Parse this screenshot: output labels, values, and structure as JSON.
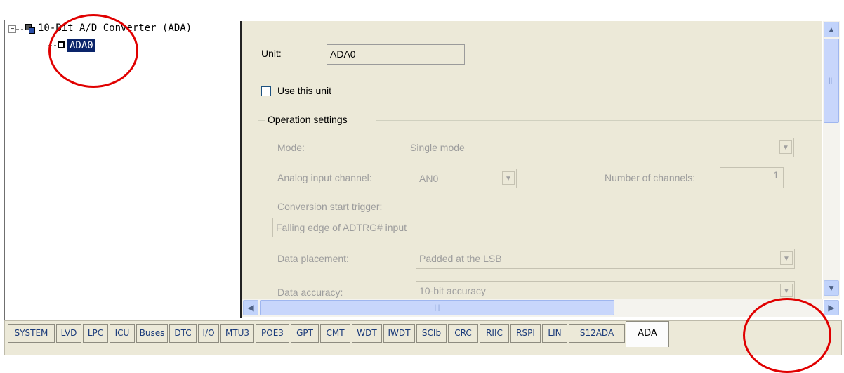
{
  "tree": {
    "root_label": "10-Bit A/D Converter (ADA)",
    "expander": "−",
    "child_label": "ADA0"
  },
  "settings": {
    "unit_label": "Unit:",
    "unit_value": "ADA0",
    "use_unit_label": "Use this unit",
    "use_unit_checked": false,
    "operation_group": "Operation settings",
    "mode_label": "Mode:",
    "mode_value": "Single mode",
    "channel_label": "Analog input channel:",
    "channel_value": "AN0",
    "num_channels_label": "Number of channels:",
    "num_channels_value": "1",
    "trigger_label": "Conversion start trigger:",
    "trigger_value": "Falling edge of ADTRG# input",
    "placement_label": "Data placement:",
    "placement_value": "Padded at the LSB",
    "accuracy_label": "Data accuracy:",
    "accuracy_value": "10-bit accuracy"
  },
  "scroll": {
    "up": "▲",
    "down": "▼",
    "left": "◀",
    "right": "▶",
    "grip": "|||"
  },
  "tabs": [
    {
      "label": "SYSTEM"
    },
    {
      "label": "LVD"
    },
    {
      "label": "LPC"
    },
    {
      "label": "ICU"
    },
    {
      "label": "Buses"
    },
    {
      "label": "DTC"
    },
    {
      "label": "I/O"
    },
    {
      "label": "MTU3"
    },
    {
      "label": "POE3"
    },
    {
      "label": "GPT"
    },
    {
      "label": "CMT"
    },
    {
      "label": "WDT"
    },
    {
      "label": "IWDT"
    },
    {
      "label": "SCIb"
    },
    {
      "label": "CRC"
    },
    {
      "label": "RIIC"
    },
    {
      "label": "RSPI"
    },
    {
      "label": "LIN"
    },
    {
      "label": "S12ADA"
    },
    {
      "label": "ADA"
    }
  ],
  "active_tab": "ADA",
  "colors": {
    "selection": "#0a246a",
    "panel": "#ece9d8",
    "annotation": "#e00000"
  }
}
